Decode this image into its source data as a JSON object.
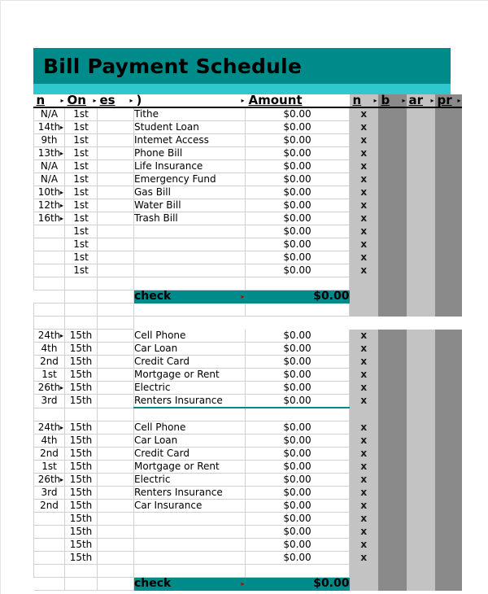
{
  "document": {
    "title": "Bill Payment Schedule",
    "type": "spreadsheet"
  },
  "colors": {
    "title_bar": "#008b8b",
    "title_band": "#2ec8ce",
    "total_bar": "#008b8b",
    "gray_light": "#c3c3c3",
    "gray_dark": "#8a8a8a",
    "grid_line": "#d0d0d0",
    "overflow_marker": "#c00000"
  },
  "headers": {
    "due": "n",
    "on": "On",
    "bank": "es",
    "description": ")",
    "amount": "Amount",
    "g1": "n",
    "g2": "b",
    "g3": "ar",
    "g4": "pr",
    "overflow_marker": "▸"
  },
  "marks": {
    "x": "x"
  },
  "sections": [
    {
      "id": "section-1st",
      "rows": [
        {
          "due": "N/A",
          "due_truncated": false,
          "on": "1st",
          "bank": "",
          "description": "Tithe",
          "amount": "$0.00",
          "mark": "x"
        },
        {
          "due": "14th",
          "due_truncated": true,
          "on": "1st",
          "bank": "",
          "description": "Student Loan",
          "amount": "$0.00",
          "mark": "x"
        },
        {
          "due": "9th",
          "due_truncated": false,
          "on": "1st",
          "bank": "",
          "description": "Intemet Access",
          "amount": "$0.00",
          "mark": "x"
        },
        {
          "due": "13th",
          "due_truncated": true,
          "on": "1st",
          "bank": "",
          "description": "Phone Bill",
          "amount": "$0.00",
          "mark": "x"
        },
        {
          "due": "N/A",
          "due_truncated": false,
          "on": "1st",
          "bank": "",
          "description": "Life Insurance",
          "amount": "$0.00",
          "mark": "x"
        },
        {
          "due": "N/A",
          "due_truncated": false,
          "on": "1st",
          "bank": "",
          "description": "Emergency Fund",
          "amount": "$0.00",
          "mark": "x"
        },
        {
          "due": "10th",
          "due_truncated": true,
          "on": "1st",
          "bank": "",
          "description": "Gas Bill",
          "amount": "$0.00",
          "mark": "x"
        },
        {
          "due": "12th",
          "due_truncated": true,
          "on": "1st",
          "bank": "",
          "description": "Water Bill",
          "amount": "$0.00",
          "mark": "x"
        },
        {
          "due": "16th",
          "due_truncated": true,
          "on": "1st",
          "bank": "",
          "description": "Trash Bill",
          "amount": "$0.00",
          "mark": "x"
        },
        {
          "due": "",
          "due_truncated": false,
          "on": "1st",
          "bank": "",
          "description": "",
          "amount": "$0.00",
          "mark": "x"
        },
        {
          "due": "",
          "due_truncated": false,
          "on": "1st",
          "bank": "",
          "description": "",
          "amount": "$0.00",
          "mark": "x"
        },
        {
          "due": "",
          "due_truncated": false,
          "on": "1st",
          "bank": "",
          "description": "",
          "amount": "$0.00",
          "mark": "x"
        },
        {
          "due": "",
          "due_truncated": false,
          "on": "1st",
          "bank": "",
          "description": "",
          "amount": "$0.00",
          "mark": "x"
        }
      ],
      "total": {
        "label": "check",
        "amount": "$0.00"
      }
    },
    {
      "id": "section-15th-a",
      "rows": [
        {
          "due": "24th",
          "due_truncated": true,
          "on": "15th",
          "bank": "",
          "description": "Cell Phone",
          "amount": "$0.00",
          "mark": "x"
        },
        {
          "due": "4th",
          "due_truncated": false,
          "on": "15th",
          "bank": "",
          "description": "Car Loan",
          "amount": "$0.00",
          "mark": "x"
        },
        {
          "due": "2nd",
          "due_truncated": false,
          "on": "15th",
          "bank": "",
          "description": "Credit Card",
          "amount": "$0.00",
          "mark": "x"
        },
        {
          "due": "1st",
          "due_truncated": false,
          "on": "15th",
          "bank": "",
          "description": "Mortgage or Rent",
          "amount": "$0.00",
          "mark": "x"
        },
        {
          "due": "26th",
          "due_truncated": true,
          "on": "15th",
          "bank": "",
          "description": "Electric",
          "amount": "$0.00",
          "mark": "x"
        },
        {
          "due": "3rd",
          "due_truncated": false,
          "on": "15th",
          "bank": "",
          "description": "Renters Insurance",
          "amount": "$0.00",
          "mark": "x"
        }
      ],
      "total": null
    },
    {
      "id": "section-15th-b",
      "rows": [
        {
          "due": "24th",
          "due_truncated": true,
          "on": "15th",
          "bank": "",
          "description": "Cell Phone",
          "amount": "$0.00",
          "mark": "x"
        },
        {
          "due": "4th",
          "due_truncated": false,
          "on": "15th",
          "bank": "",
          "description": "Car Loan",
          "amount": "$0.00",
          "mark": "x"
        },
        {
          "due": "2nd",
          "due_truncated": false,
          "on": "15th",
          "bank": "",
          "description": "Credit Card",
          "amount": "$0.00",
          "mark": "x"
        },
        {
          "due": "1st",
          "due_truncated": false,
          "on": "15th",
          "bank": "",
          "description": "Mortgage or Rent",
          "amount": "$0.00",
          "mark": "x"
        },
        {
          "due": "26th",
          "due_truncated": true,
          "on": "15th",
          "bank": "",
          "description": "Electric",
          "amount": "$0.00",
          "mark": "x"
        },
        {
          "due": "3rd",
          "due_truncated": false,
          "on": "15th",
          "bank": "",
          "description": "Renters Insurance",
          "amount": "$0.00",
          "mark": "x"
        },
        {
          "due": "2nd",
          "due_truncated": false,
          "on": "15th",
          "bank": "",
          "description": "Car Insurance",
          "amount": "$0.00",
          "mark": "x"
        },
        {
          "due": "",
          "due_truncated": false,
          "on": "15th",
          "bank": "",
          "description": "",
          "amount": "$0.00",
          "mark": "x"
        },
        {
          "due": "",
          "due_truncated": false,
          "on": "15th",
          "bank": "",
          "description": "",
          "amount": "$0.00",
          "mark": "x"
        },
        {
          "due": "",
          "due_truncated": false,
          "on": "15th",
          "bank": "",
          "description": "",
          "amount": "$0.00",
          "mark": "x"
        },
        {
          "due": "",
          "due_truncated": false,
          "on": "15th",
          "bank": "",
          "description": "",
          "amount": "$0.00",
          "mark": "x"
        }
      ],
      "total": {
        "label": "check",
        "amount": "$0.00"
      }
    }
  ]
}
